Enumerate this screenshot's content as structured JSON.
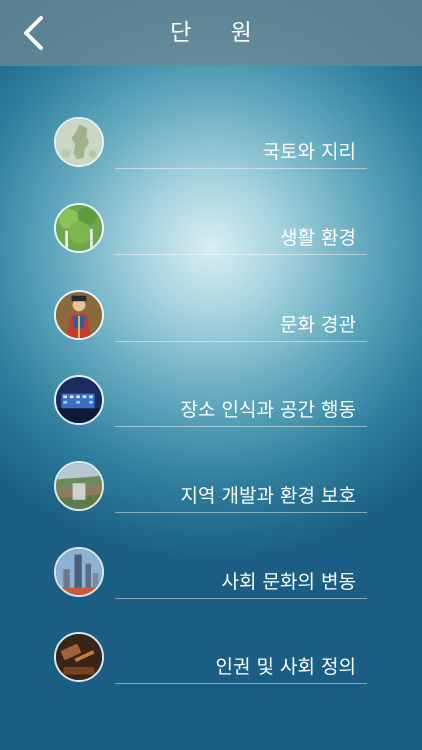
{
  "header": {
    "title": "단 원",
    "back_icon": "chevron-left-icon"
  },
  "units": [
    {
      "label": "국토와 지리",
      "thumbnail": "korea-map-thumbnail"
    },
    {
      "label": "생활 환경",
      "thumbnail": "green-trees-thumbnail"
    },
    {
      "label": "문화 경관",
      "thumbnail": "traditional-costume-thumbnail"
    },
    {
      "label": "장소 인식과 공간 행동",
      "thumbnail": "city-night-building-thumbnail"
    },
    {
      "label": "지역 개발과 환경 보호",
      "thumbnail": "terraced-landscape-thumbnail"
    },
    {
      "label": "사회 문화의 변동",
      "thumbnail": "city-skyline-thumbnail"
    },
    {
      "label": "인권 및 사회 정의",
      "thumbnail": "judge-gavel-thumbnail"
    }
  ]
}
